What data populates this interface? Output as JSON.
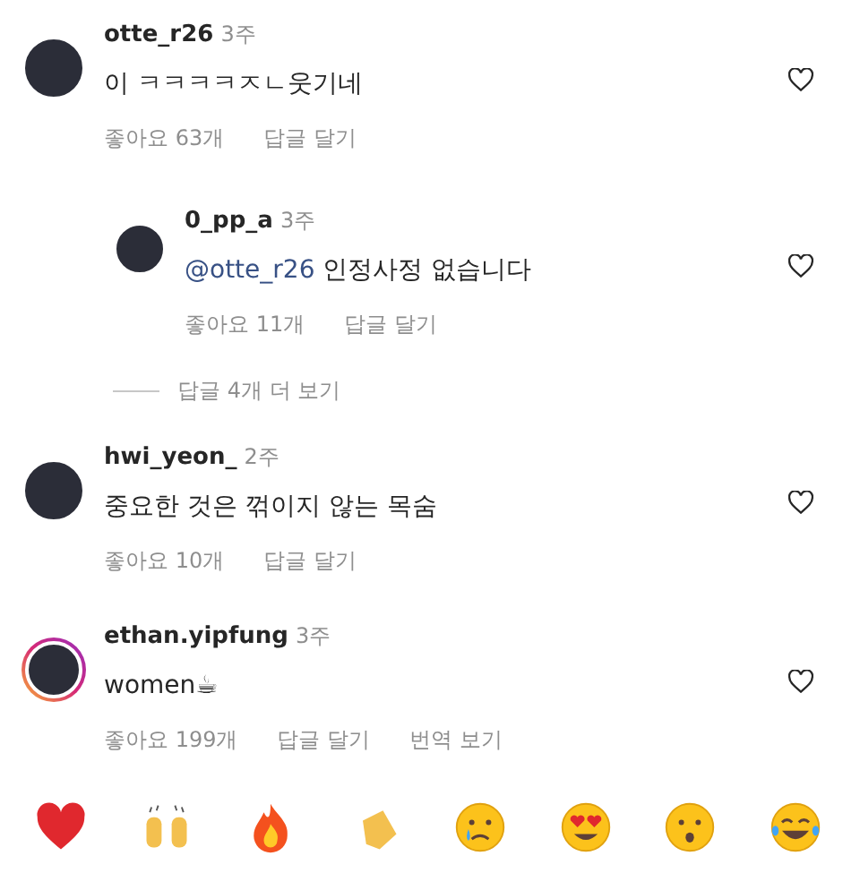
{
  "comments": [
    {
      "kind": "comment",
      "username": "otte_r26",
      "time": "3주",
      "text": "이 ㅋㅋㅋㅋㅈㄴ웃기네",
      "likes": "좋아요 63개",
      "reply": "답글 달기",
      "story_ring": false
    },
    {
      "kind": "reply",
      "username": "0_pp_a",
      "time": "3주",
      "mention": "@otte_r26",
      "text": "인정사정 없습니다",
      "likes": "좋아요 11개",
      "reply": "답글 달기",
      "story_ring": false
    },
    {
      "kind": "more",
      "text": "답글 4개 더 보기"
    },
    {
      "kind": "comment",
      "username": "hwi_yeon_",
      "time": "2주",
      "text": "중요한 것은 꺾이지 않는 목숨",
      "likes": "좋아요 10개",
      "reply": "답글 달기",
      "story_ring": false
    },
    {
      "kind": "comment",
      "username": "ethan.yipfung",
      "time": "3주",
      "text": "women☕",
      "likes": "좋아요 199개",
      "reply": "답글 달기",
      "translate": "번역 보기",
      "story_ring": true
    }
  ],
  "reactions": [
    {
      "kind": "heart"
    },
    {
      "kind": "raised-hands"
    },
    {
      "kind": "fire"
    },
    {
      "kind": "clap"
    },
    {
      "kind": "crying"
    },
    {
      "kind": "heart-eyes"
    },
    {
      "kind": "surprised"
    },
    {
      "kind": "laughing"
    }
  ]
}
